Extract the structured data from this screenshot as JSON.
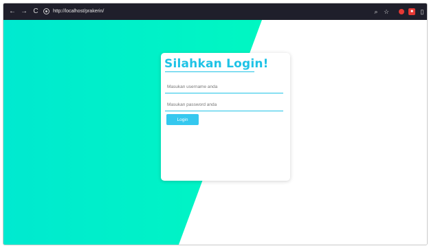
{
  "browser": {
    "url": "http://localhost/prakerin/",
    "back_icon": "←",
    "forward_icon": "→",
    "reload_icon": "C",
    "zoom_icon": "⌕",
    "star_icon": "☆",
    "ext_badge_text": "■",
    "panel_icon": "▯"
  },
  "login": {
    "title": "Silahkan Login!",
    "username_placeholder": "Masukan username anda",
    "password_placeholder": "Masukan password anda",
    "button_label": "Login"
  },
  "colors": {
    "accent": "#1fc3e6",
    "button": "#35c8ef",
    "bg_gradient_left": "#00e9cf",
    "bg_gradient_right": "#00f5c4",
    "browser_bar": "#1f1f2b"
  }
}
